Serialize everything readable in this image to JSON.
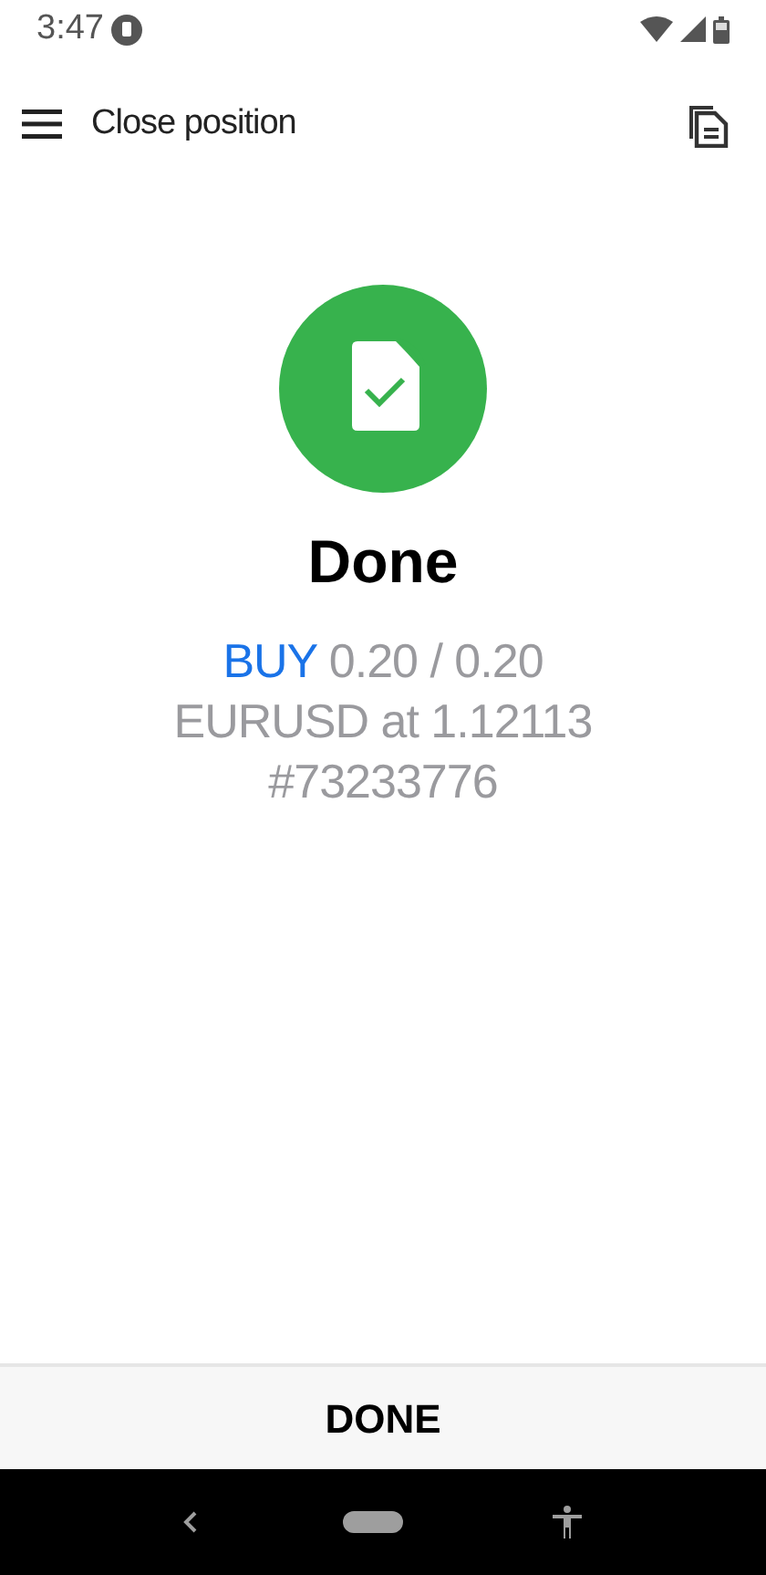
{
  "status_bar": {
    "time": "3:47"
  },
  "toolbar": {
    "title": "Close position"
  },
  "result": {
    "title": "Done",
    "side": "BUY",
    "volume": "0.20 / 0.20",
    "instrument": "EURUSD at 1.12113",
    "ticket": "#73233776"
  },
  "footer_button": {
    "label": "DONE"
  }
}
